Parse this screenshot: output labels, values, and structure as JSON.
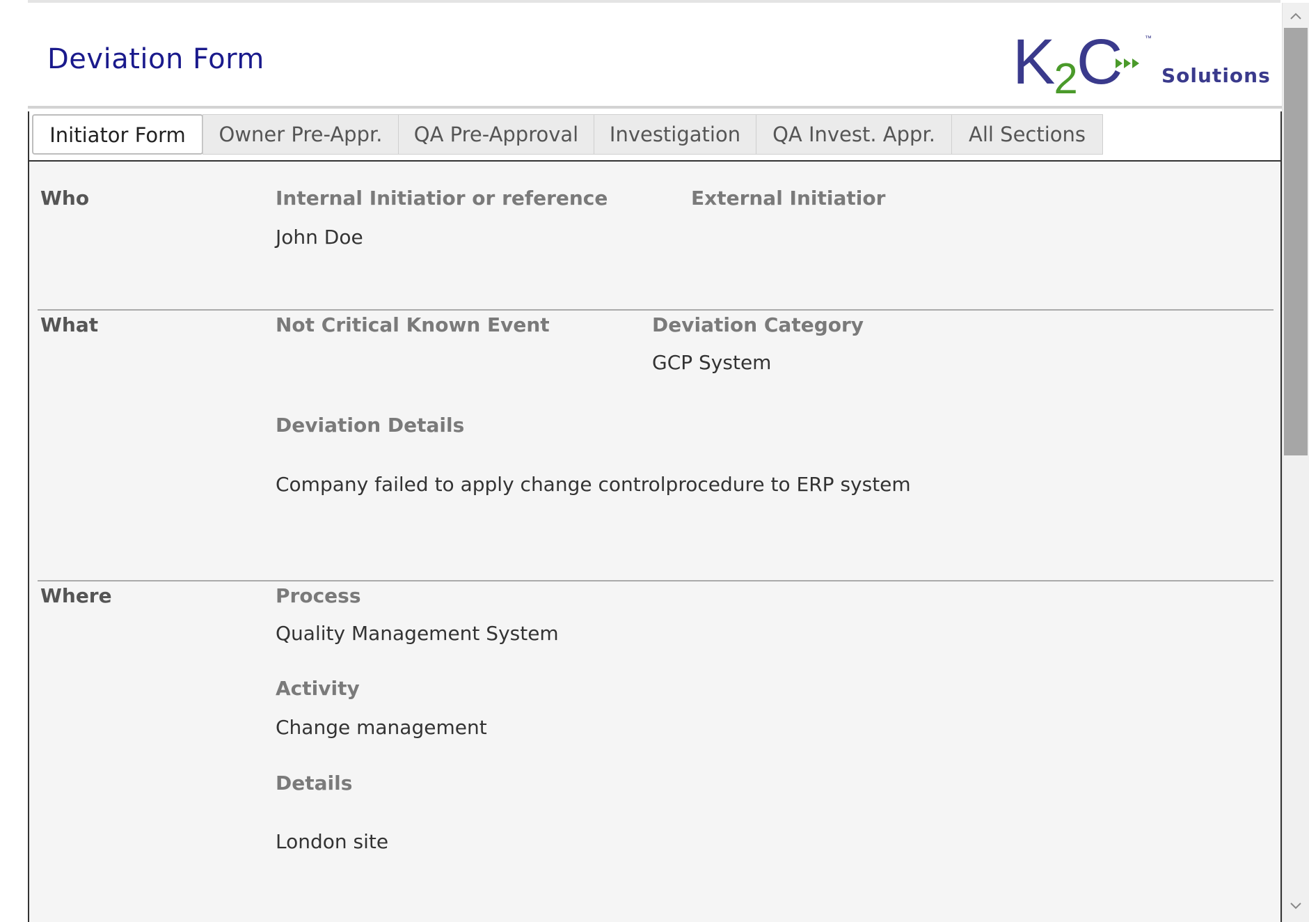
{
  "header": {
    "title": "Deviation Form",
    "logo": {
      "mark_k": "K",
      "mark_2": "2",
      "mark_c": "C",
      "tm": "™",
      "solutions": "Solutions"
    }
  },
  "tabs": [
    {
      "label": "Initiator Form",
      "active": true
    },
    {
      "label": "Owner Pre-Appr.",
      "active": false
    },
    {
      "label": "QA Pre-Approval",
      "active": false
    },
    {
      "label": "Investigation",
      "active": false
    },
    {
      "label": "QA Invest. Appr.",
      "active": false
    },
    {
      "label": "All Sections",
      "active": false
    }
  ],
  "sections": {
    "who": {
      "label": "Who",
      "internal_label": "Internal Initiatior or reference",
      "internal_value": "John Doe",
      "external_label": "External Initiatior",
      "external_value": ""
    },
    "what": {
      "label": "What",
      "event_label": "Not Critical Known Event",
      "category_label": "Deviation Category",
      "category_value": "GCP System",
      "details_label": "Deviation Details",
      "details_value": "Company failed to apply change controlprocedure to ERP system"
    },
    "where": {
      "label": "Where",
      "process_label": "Process",
      "process_value": "Quality Management System",
      "activity_label": "Activity",
      "activity_value": "Change management",
      "details_label": "Details",
      "details_value": "London site"
    }
  },
  "colors": {
    "title": "#1a1a8c",
    "logo_primary": "#3a3a8c",
    "logo_accent": "#4a9a2a",
    "content_background": "#f5f5f5",
    "label_gray": "#7a7a7a"
  },
  "icons": {
    "scroll_up": "chevron-up-icon",
    "scroll_down": "chevron-down-icon",
    "logo_arrows": "triple-arrow-icon"
  }
}
